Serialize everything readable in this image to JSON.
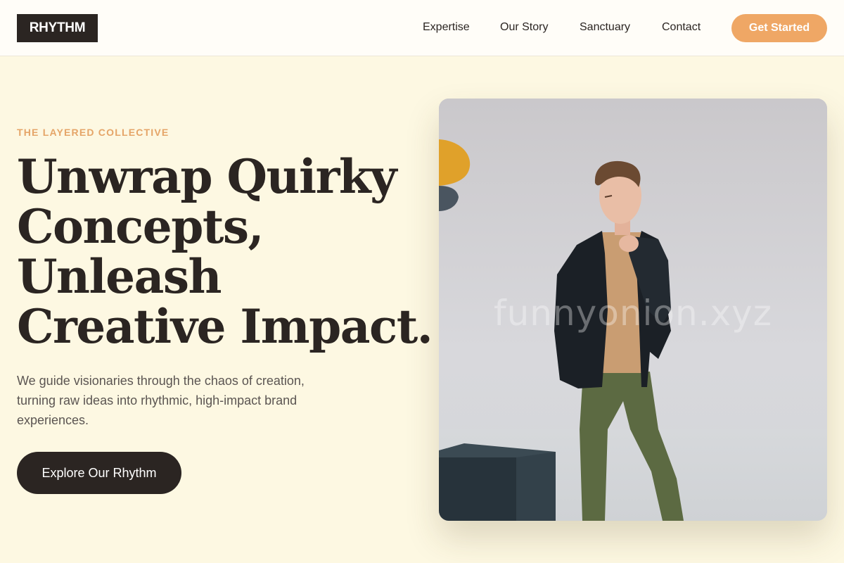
{
  "header": {
    "logo": "RHYTHM",
    "nav": [
      "Expertise",
      "Our Story",
      "Sanctuary",
      "Contact"
    ],
    "cta_label": "Get Started"
  },
  "hero": {
    "eyebrow": "THE LAYERED COLLECTIVE",
    "headline_lines": [
      "Unwrap Quirky",
      "Concepts,",
      "Unleash",
      "Creative Impact."
    ],
    "subtext": "We guide visionaries through the chaos of creation, turning raw ideas into rhythmic, high-impact brand experiences.",
    "button_label": "Explore Our Rhythm"
  },
  "photo": {
    "subject": "man in dark blazer and green trousers standing beside a dark block",
    "watermark": "funnyonion.xyz"
  },
  "colors": {
    "background": "#fdf8e2",
    "header_bg": "#fffdf8",
    "dark": "#2b2522",
    "accent": "#efa765",
    "eyebrow": "#e5a568",
    "body_text": "#5b5552"
  }
}
